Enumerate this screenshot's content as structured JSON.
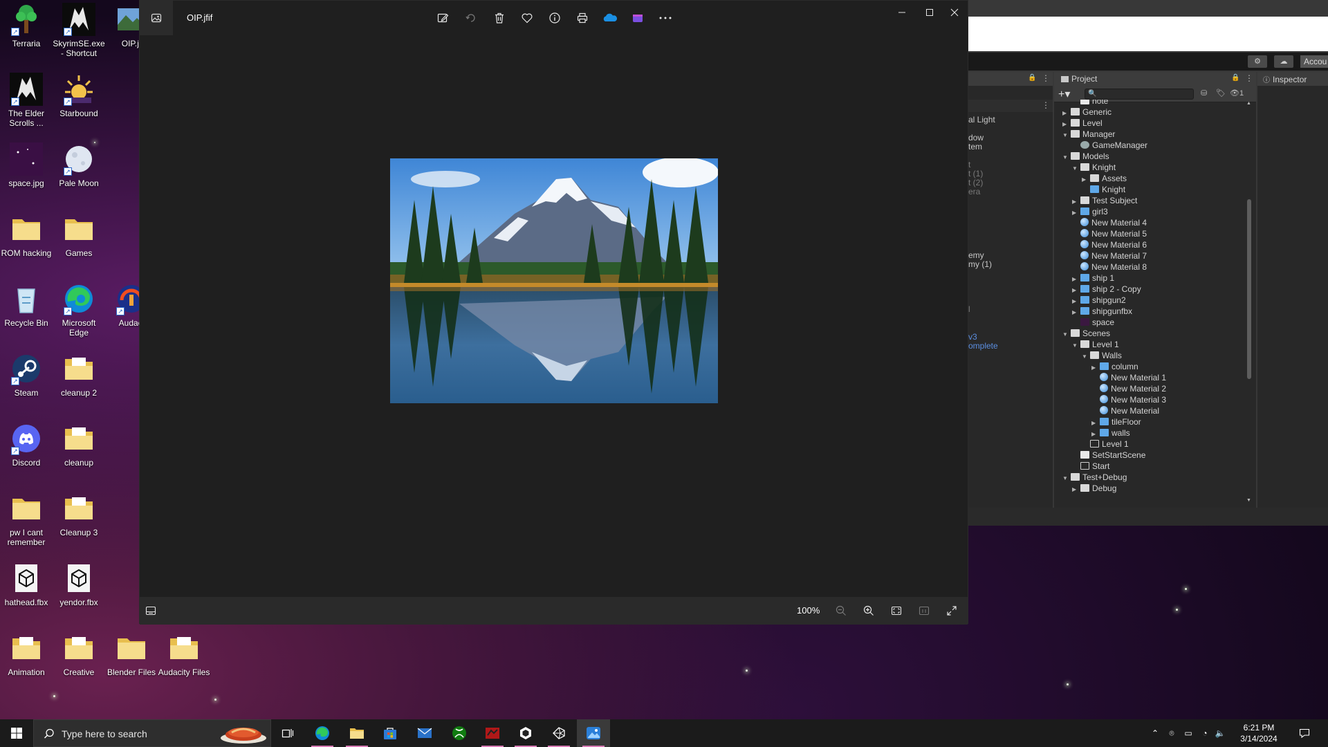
{
  "desktop": {
    "icons": [
      {
        "label": "Terraria"
      },
      {
        "label": "SkyrimSE.exe - Shortcut"
      },
      {
        "label": "OIP.jf"
      },
      {
        "label": "The Elder Scrolls ..."
      },
      {
        "label": "Starbound"
      },
      {
        "label": "space.jpg"
      },
      {
        "label": "Pale Moon"
      },
      {
        "label": "ROM hacking"
      },
      {
        "label": "Games"
      },
      {
        "label": "Recycle Bin"
      },
      {
        "label": "Microsoft Edge"
      },
      {
        "label": "Audaci"
      },
      {
        "label": "Steam"
      },
      {
        "label": "cleanup 2"
      },
      {
        "label": "Discord"
      },
      {
        "label": "cleanup"
      },
      {
        "label": "pw I cant remember"
      },
      {
        "label": "Cleanup 3"
      },
      {
        "label": "hathead.fbx"
      },
      {
        "label": "yendor.fbx"
      },
      {
        "label": "Animation"
      },
      {
        "label": "Creative"
      },
      {
        "label": "Blender Files"
      },
      {
        "label": "Audacity Files"
      }
    ]
  },
  "photos": {
    "file_name": "OIP.jfif",
    "zoom": "100%",
    "toolbar_icons": [
      "edit-image-icon",
      "rotate-icon",
      "delete-icon",
      "favorite-icon",
      "file-info-icon",
      "print-icon",
      "onedrive-icon",
      "clipchamp-icon",
      "more-icon"
    ],
    "window_controls": [
      "minimize-icon",
      "maximize-icon",
      "close-icon"
    ]
  },
  "unity": {
    "account_label": "Accou",
    "hierarchy_items": [
      {
        "text": "al Light",
        "style": ""
      },
      {
        "text": "dow",
        "style": ""
      },
      {
        "text": "tem",
        "style": ""
      },
      {
        "text": "t",
        "style": "grey"
      },
      {
        "text": "t (1)",
        "style": "grey"
      },
      {
        "text": "t (2)",
        "style": "grey"
      },
      {
        "text": "era",
        "style": "grey"
      },
      {
        "text": "emy",
        "style": ""
      },
      {
        "text": "my (1)",
        "style": ""
      },
      {
        "text": "l",
        "style": "grey"
      },
      {
        "text": "v3",
        "style": "blue"
      },
      {
        "text": "omplete",
        "style": "blue"
      }
    ],
    "project_tab": "Project",
    "inspector_tab": "Inspector",
    "hidden_count": "1",
    "tree": [
      {
        "label": "note",
        "depth": 2,
        "arrow": "",
        "icon": "script"
      },
      {
        "label": "Generic",
        "depth": 1,
        "arrow": "right",
        "icon": "folder"
      },
      {
        "label": "Level",
        "depth": 1,
        "arrow": "right",
        "icon": "folder"
      },
      {
        "label": "Manager",
        "depth": 1,
        "arrow": "down",
        "icon": "folder"
      },
      {
        "label": "GameManager",
        "depth": 2,
        "arrow": "",
        "icon": "gear"
      },
      {
        "label": "Models",
        "depth": 1,
        "arrow": "down",
        "icon": "folder"
      },
      {
        "label": "Knight",
        "depth": 2,
        "arrow": "down",
        "icon": "folder"
      },
      {
        "label": "Assets",
        "depth": 3,
        "arrow": "right",
        "icon": "folder"
      },
      {
        "label": "Knight",
        "depth": 3,
        "arrow": "",
        "icon": "model"
      },
      {
        "label": "Test Subject",
        "depth": 2,
        "arrow": "right",
        "icon": "folder"
      },
      {
        "label": "girl3",
        "depth": 2,
        "arrow": "right",
        "icon": "model"
      },
      {
        "label": "New Material 4",
        "depth": 2,
        "arrow": "",
        "icon": "material"
      },
      {
        "label": "New Material 5",
        "depth": 2,
        "arrow": "",
        "icon": "material"
      },
      {
        "label": "New Material 6",
        "depth": 2,
        "arrow": "",
        "icon": "material"
      },
      {
        "label": "New Material 7",
        "depth": 2,
        "arrow": "",
        "icon": "material"
      },
      {
        "label": "New Material 8",
        "depth": 2,
        "arrow": "",
        "icon": "material"
      },
      {
        "label": "ship 1",
        "depth": 2,
        "arrow": "right",
        "icon": "model"
      },
      {
        "label": "ship 2 - Copy",
        "depth": 2,
        "arrow": "right",
        "icon": "model"
      },
      {
        "label": "shipgun2",
        "depth": 2,
        "arrow": "right",
        "icon": "model"
      },
      {
        "label": "shipgunfbx",
        "depth": 2,
        "arrow": "right",
        "icon": "model"
      },
      {
        "label": "space",
        "depth": 2,
        "arrow": "",
        "icon": "dark"
      },
      {
        "label": "Scenes",
        "depth": 1,
        "arrow": "down",
        "icon": "folder"
      },
      {
        "label": "Level 1",
        "depth": 2,
        "arrow": "down",
        "icon": "folder"
      },
      {
        "label": "Walls",
        "depth": 3,
        "arrow": "down",
        "icon": "folder"
      },
      {
        "label": "column",
        "depth": 4,
        "arrow": "right",
        "icon": "model"
      },
      {
        "label": "New Material 1",
        "depth": 4,
        "arrow": "",
        "icon": "material"
      },
      {
        "label": "New Material 2",
        "depth": 4,
        "arrow": "",
        "icon": "material"
      },
      {
        "label": "New Material 3",
        "depth": 4,
        "arrow": "",
        "icon": "material"
      },
      {
        "label": "New Material",
        "depth": 4,
        "arrow": "",
        "icon": "material"
      },
      {
        "label": "tileFloor",
        "depth": 4,
        "arrow": "right",
        "icon": "model"
      },
      {
        "label": "walls",
        "depth": 4,
        "arrow": "right",
        "icon": "model"
      },
      {
        "label": "Level 1",
        "depth": 3,
        "arrow": "",
        "icon": "scene"
      },
      {
        "label": "SetStartScene",
        "depth": 2,
        "arrow": "",
        "icon": "script"
      },
      {
        "label": "Start",
        "depth": 2,
        "arrow": "",
        "icon": "scene"
      },
      {
        "label": "Test+Debug",
        "depth": 1,
        "arrow": "down",
        "icon": "folder"
      },
      {
        "label": "Debug",
        "depth": 2,
        "arrow": "right",
        "icon": "folder"
      }
    ]
  },
  "taskbar": {
    "search_placeholder": "Type here to search",
    "time": "6:21 PM",
    "date": "3/14/2024",
    "pinned": [
      "task-view-icon",
      "edge-icon",
      "file-explorer-icon",
      "store-icon",
      "mail-icon",
      "xbox-icon",
      "game-icon",
      "unity-hub-icon",
      "unity-icon",
      "photos-icon"
    ]
  }
}
